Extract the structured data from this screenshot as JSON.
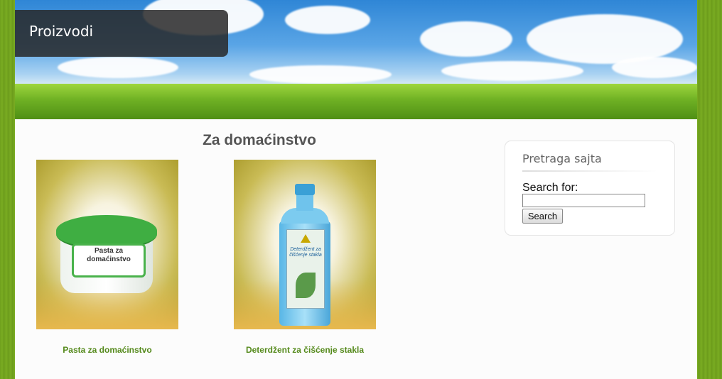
{
  "header": {
    "title": "Proizvodi"
  },
  "main": {
    "heading": "Za domaćinstvo",
    "products": [
      {
        "name": "Pasta za domaćinstvo",
        "image_text": "Pasta za domaćinstvo"
      },
      {
        "name": "Deterdžent za čišćenje stakla",
        "image_text": "Deterdžent za čišćenje stakla"
      }
    ]
  },
  "sidebar": {
    "widget_title": "Pretraga sajta",
    "search_label": "Search for:",
    "search_value": "",
    "search_button": "Search"
  },
  "colors": {
    "page_bg": "#6f9f1d",
    "product_link": "#558a1c",
    "heading": "#555555",
    "title_box": "#282828"
  }
}
